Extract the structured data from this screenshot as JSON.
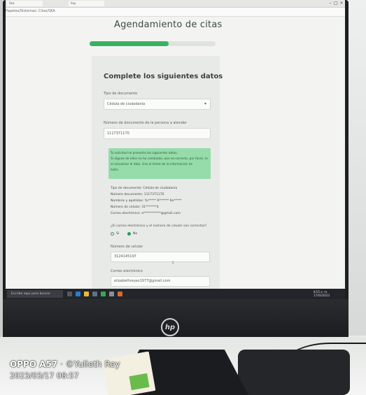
{
  "browser": {
    "tabs": [
      "Sea",
      "hoy"
    ],
    "address": "Papeles/Sistemas: Citas/SKA"
  },
  "page": {
    "title": "Agendamiento de citas",
    "progress_percent": 63
  },
  "form": {
    "heading": "Complete los siguientes datos",
    "doc_type_label": "Tipo de documento",
    "doc_type_value": "Cédula de ciudadanía",
    "doc_number_label": "Número de documento de la persona a atender",
    "doc_number_value": "1117371170",
    "alert_lines": [
      "Tu solicitud se presenta los siguientes datos.",
      "Si alguno de ellos no ha cambiado, aún es correcto, por favor, lo",
      "el actualizar el dato. Usa el ticket de la información de",
      "éxito."
    ],
    "info_lines": [
      "Tipo de documento: Cédula de ciudadanía",
      "Número documento: 1117371170",
      "Nombres y apellidos: Yu***** R****** Ro*****",
      "Número de celular: 31*******4",
      "Correo electrónico: a***********@gmail.com"
    ],
    "question": "¿El correo electrónico y el número de celular son correctos?",
    "options": [
      "Sí",
      "No"
    ],
    "selected_option": "No",
    "phone_label": "Número de celular",
    "phone_value": "3124145197",
    "email_label": "Correo electrónico",
    "email_value": "elizabethreyes1977@gmail.com"
  },
  "taskbar": {
    "search_placeholder": "Escribe aquí para buscar",
    "time": "8:55 a. m.",
    "date": "17/03/2023"
  },
  "monitor": {
    "brand_logo": "hp"
  },
  "photo_stamp": {
    "brand": "OPPO A57",
    "author": "· ©Yulieth Rey",
    "datetime": "2023/03/17 08:57"
  },
  "colors": {
    "accent_green": "#3ab162",
    "alert_green": "#95dcaa"
  }
}
